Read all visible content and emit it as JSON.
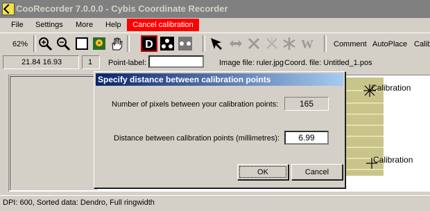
{
  "window": {
    "title": "CooRecorder 7.0.0.0 - Cybis Coordinate Recorder"
  },
  "menu": {
    "items": [
      "File",
      "Settings",
      "More",
      "Help"
    ],
    "cancel_calibration": "Cancel calibration"
  },
  "toolbar": {
    "zoom": "62%",
    "comment": "Comment",
    "autoplace": "AutoPlace",
    "calib": "Calib"
  },
  "info": {
    "coords": "21.84  16.93",
    "count": "1",
    "point_label_caption": "Point-label:",
    "point_label_value": "",
    "image_file": "Image file: ruler.jpg",
    "coord_file": "Coord. file: Untitled_1.pos"
  },
  "canvas": {
    "calib_label_1": "Calibration",
    "calib_label_2": "Calibration"
  },
  "dialog": {
    "title": "Specify distance between calibration points",
    "pixels_label": "Number of pixels between your calibration points:",
    "pixels_value": "165",
    "distance_label": "Distance between calibration points (millimetres):",
    "distance_value": "6.99",
    "ok": "OK",
    "cancel": "Cancel"
  },
  "status": {
    "text": "DPI: 600,   Sorted data: Dendro, Full ringwidth"
  },
  "colors": {
    "cancel_bg": "#ff0000",
    "title_inactive": "#808080",
    "dialog_title": "#0a246a"
  }
}
